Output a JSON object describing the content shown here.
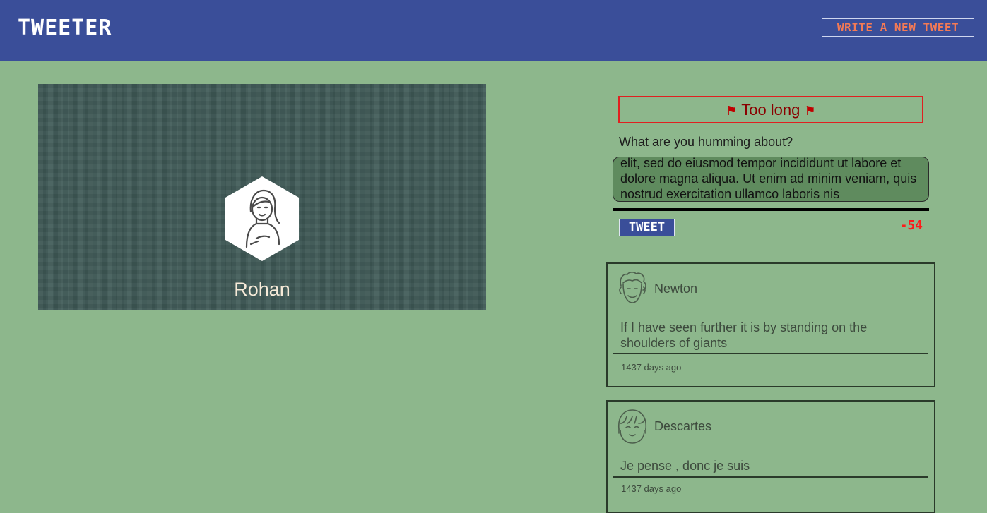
{
  "header": {
    "brand": "TWEETER",
    "write_button": "WRITE A NEW TWEET"
  },
  "profile": {
    "name": "Rohan",
    "avatar_icon": "user-avatar-icon"
  },
  "composer": {
    "error": "Too long",
    "label": "What are you humming about?",
    "text": "elit, sed do eiusmod tempor incididunt ut labore et dolore magna aliqua. Ut enim ad minim veniam, quis nostrud exercitation ullamco laboris nis",
    "submit_label": "TWEET",
    "counter": "-54"
  },
  "tweets": [
    {
      "author": "Newton",
      "body": "If I have seen further it is by standing on the shoulders of giants",
      "time": "1437 days ago"
    },
    {
      "author": "Descartes",
      "body": "Je pense , donc je suis",
      "time": "1437 days ago"
    }
  ],
  "colors": {
    "background": "#8db78c",
    "nav": "#3a4e99",
    "accent": "#f47a55",
    "error": "#e02020",
    "counter": "#ff1a1a"
  }
}
